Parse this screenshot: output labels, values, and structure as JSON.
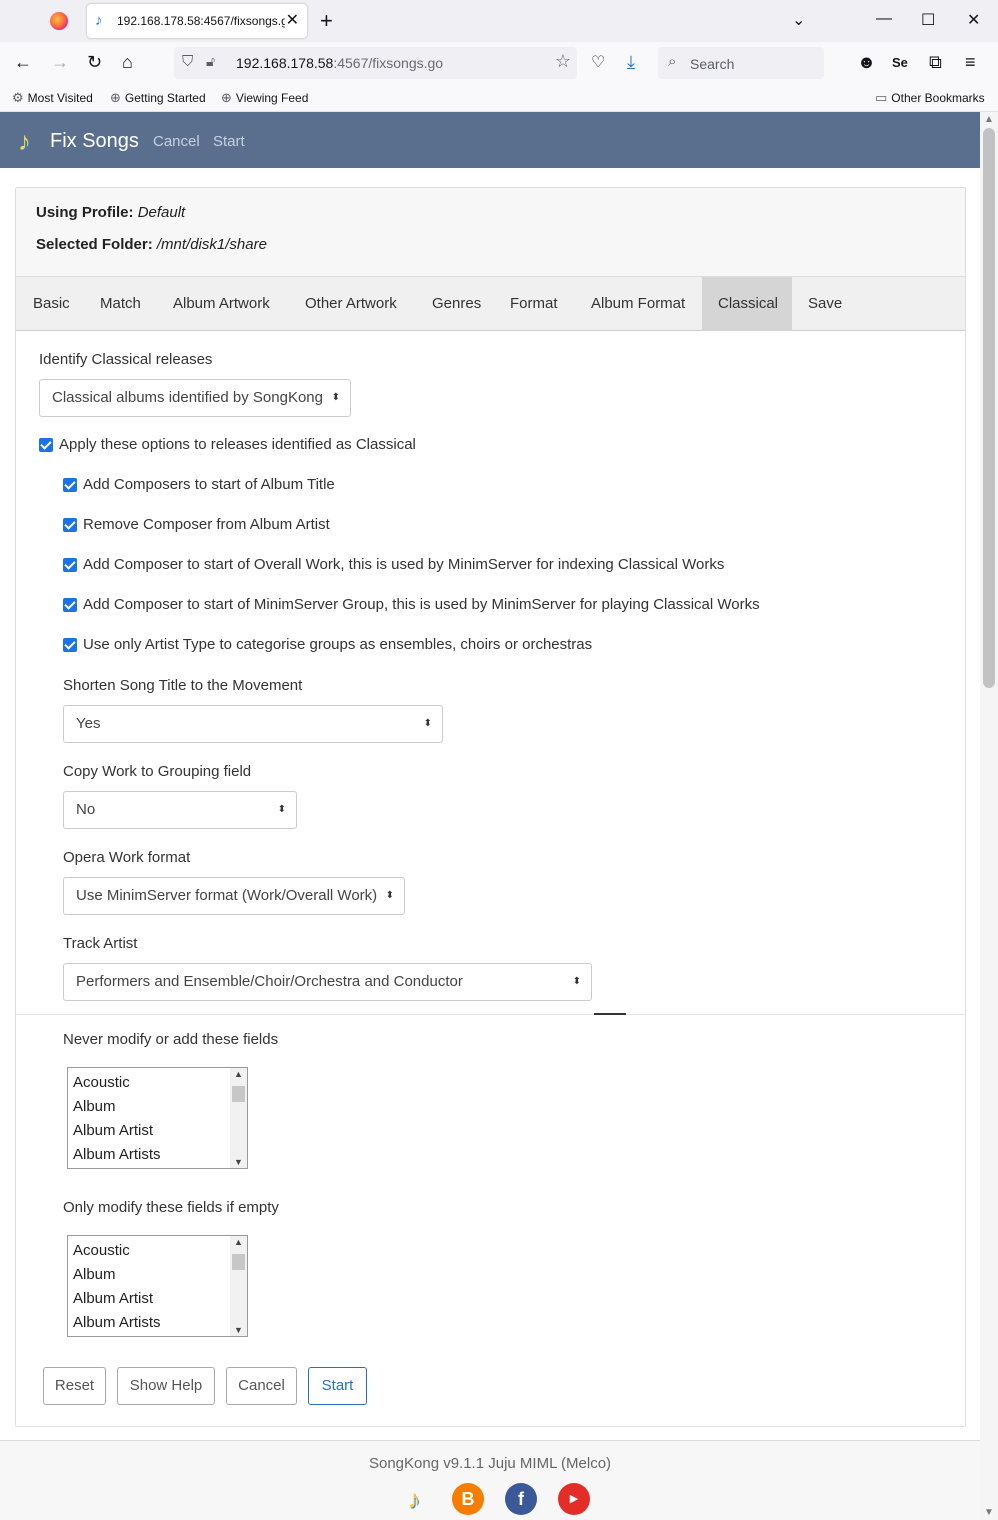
{
  "browser": {
    "tab_title": "192.168.178.58:4567/fixsongs.go",
    "url_host": "192.168.178.58",
    "url_rest": ":4567/fixsongs.go",
    "search_placeholder": "Search",
    "bookmarks": [
      "Most Visited",
      "Getting Started",
      "Viewing Feed"
    ],
    "other_bookmarks": "Other Bookmarks"
  },
  "app": {
    "brand": "Fix Songs",
    "nav": [
      "Cancel",
      "Start"
    ]
  },
  "info": {
    "profile_label": "Using Profile:",
    "profile_value": "Default",
    "folder_label": "Selected Folder:",
    "folder_value": "/mnt/disk1/share"
  },
  "tabs": [
    "Basic",
    "Match",
    "Album Artwork",
    "Other Artwork",
    "Genres",
    "Format",
    "Album Format",
    "Classical",
    "Save"
  ],
  "active_tab": "Classical",
  "classical": {
    "identify_label": "Identify Classical releases",
    "identify_value": "Classical albums identified by SongKong",
    "apply_label": "Apply these options to releases identified as Classical",
    "options": [
      "Add Composers to start of Album Title",
      "Remove Composer from Album Artist",
      "Add Composer to start of Overall Work, this is used by MinimServer for indexing Classical Works",
      "Add Composer to start of MinimServer Group, this is used by MinimServer for playing Classical Works",
      "Use only Artist Type to categorise groups as ensembles, choirs or orchestras"
    ],
    "shorten_label": "Shorten Song Title to the Movement",
    "shorten_value": "Yes",
    "copywork_label": "Copy Work to Grouping field",
    "copywork_value": "No",
    "opera_label": "Opera Work format",
    "opera_value": "Use MinimServer format (Work/Overall Work)",
    "trackartist_label": "Track Artist",
    "trackartist_value": "Performers and Ensemble/Choir/Orchestra and Conductor"
  },
  "fields": {
    "never_label": "Never modify or add these fields",
    "empty_label": "Only modify these fields if empty",
    "items": [
      "Acoustic",
      "Album",
      "Album Artist",
      "Album Artists"
    ]
  },
  "buttons": {
    "reset": "Reset",
    "help": "Show Help",
    "cancel": "Cancel",
    "start": "Start"
  },
  "footer": {
    "version": "SongKong v9.1.1 Juju MIML (Melco)"
  },
  "colors": {
    "appbar": "#5a6f8e",
    "checkbox": "#1a73e8",
    "primary_button": "#2a6fb8"
  }
}
